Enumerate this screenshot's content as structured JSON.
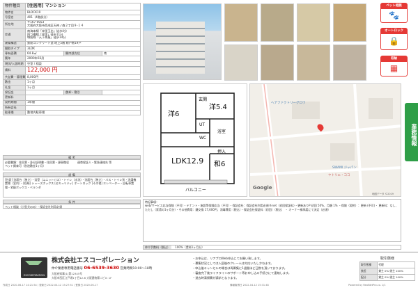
{
  "rows": [
    {
      "k": "物件種目",
      "v": "[住居用] マンション",
      "big": true
    },
    {
      "k": "物件名",
      "v": "BLOCK19"
    },
    {
      "k": "号室名",
      "v": "401（4階部分）"
    },
    {
      "k": "所在地",
      "v": "〒167-0053\n大阪府大阪市西成区天神ノ森２丁目９-１４",
      "tall": true
    },
    {
      "k": "交通",
      "v": "南海本線「岸里玉出」徒歩4分\n四つ橋線「岸里」徒歩11分\n堺筋線「天下茶屋」徒歩14分",
      "tall3": true
    },
    {
      "k": "建築構造",
      "v": "鉄筋コンクリート造 地上5階 総戸数19戸"
    },
    {
      "k": "間取タイプ",
      "v": "3LDK"
    },
    {
      "k": "専有面積",
      "v": "64.8㎡",
      "k2": "開口部方位",
      "v2": "南"
    },
    {
      "k": "築年",
      "v": "2000年03月"
    },
    {
      "k": "現況/入居時期",
      "v": "空室 / 相談"
    },
    {
      "k": "賃料",
      "v": "122,000 円",
      "rent": true
    },
    {
      "k": "共益費・管理費",
      "v": "8,000円"
    },
    {
      "k": "敷金",
      "v": "1ヶ月"
    },
    {
      "k": "礼金",
      "v": "1ヶ月"
    },
    {
      "k": "保証金",
      "v": "",
      "k2": "償却・敷引",
      "v2": ""
    },
    {
      "k": "更新料",
      "v": ""
    },
    {
      "k": "契約期間",
      "v": "1年間"
    },
    {
      "k": "所有会社",
      "v": ""
    },
    {
      "k": "駐車場",
      "v": "敷地内駐車場"
    }
  ],
  "labels": {
    "biko": "備 考",
    "setsubi": "設 備",
    "joken": "条 件",
    "torihiki": "取引態様"
  },
  "biko_text": "必要書類：住民票・身分証明書・住民票・源泉徴収　　　連帯保証人・緊急連絡先 等\nペット飼育可（別途敷金1ヶ月）",
  "setsubi_text": "[住設] 洗面台（独立）・浴室（ユニットバス）・トイレ（水洗）・洗面台（独立）・バス・トイレ別・洗濯機置場（室内）・[収納] シューズボックス [セキュリティ] オートロック [その他] エレベーター・自転車置場・宅配ボックス・ベランダ",
  "joken_text": "ペット相談（小型犬のみ）・保証会社利用必須",
  "floor": {
    "r1": "洋6",
    "r2": "洋5.4",
    "r3": "LDK12.9",
    "r4": "和6",
    "ub": "UT",
    "bath": "浴室",
    "wc": "WC",
    "oshi": "押入",
    "gen": "玄関",
    "bal": "バルコニー",
    "kura": "収納"
  },
  "map": {
    "label": "ヘアファクトリーグロウ",
    "label2": "ヤトリエ・ココ",
    "label3": "SWAMI ジャパン",
    "google": "Google",
    "copy": "地図データ ©2019"
  },
  "note_head": "特記事項：",
  "note_text": "web/サービス応当保険（不可）・テナント・施設等保険応当（不可）・保証会社：保証会社利用必須 K-net（初回保証料）・更新ありP 初回 50%、月額 1% ・保険（契約）：更新 (不可)・ 更新料：なし、ただし（家賃の1ヶ月分）・その他費用：鍵交換 17,600円、消毒費用（税込）・保証会社保証料（初回）（税込） ・ オーナー様承諾にて決定（必須）",
  "rent_row": {
    "label": "仲介手数料（税込）",
    "amount": "100%（賃料1ヶ月分）"
  },
  "badges": {
    "pet": "ペット相談",
    "auto": "オートロック",
    "storage": "収納"
  },
  "side_tab": "業務情報",
  "company": {
    "name": "株式会社エスコーポレーション",
    "addr": "仲介業者専用電話番号",
    "tel": "06-6539-3630",
    "hours": "営業時間10:00～18時",
    "license": "大阪府知事(1)第12345号",
    "address": "大阪市西区江戸堀1丁目12-6 大阪建物第二ビル 1F",
    "logo": "ESCORPORATION"
  },
  "notes": [
    "・お申込は、リアプロWeb申込にてお願い致します。",
    "・募集状況としては入居後のクレームは対応いたしかねます。",
    "・申込後キャンセルの場合は再募集に1週間ほど日数を頂いております。",
    "・審査完了後ライフラインのサポート等お申し込み手続きにて連絡します。",
    "・退去時清掃費が請求となります。"
  ],
  "torihiki": {
    "rows": [
      [
        "取引態様",
        "代理"
      ],
      [
        "負担",
        "貸主 0% 借主 100%"
      ],
      [
        "配分",
        "貸主 0% 借主 100%"
      ]
    ]
  },
  "footer": {
    "left": "作成日 2020-06-17 14:21:54 / 更新日 2022-04-12 15:27:51 / 登録日 2020-06-17",
    "center": "情報取得日 2022-04-12 15:31:48",
    "right": "Powered by RealNetPro.co. 1/1"
  }
}
